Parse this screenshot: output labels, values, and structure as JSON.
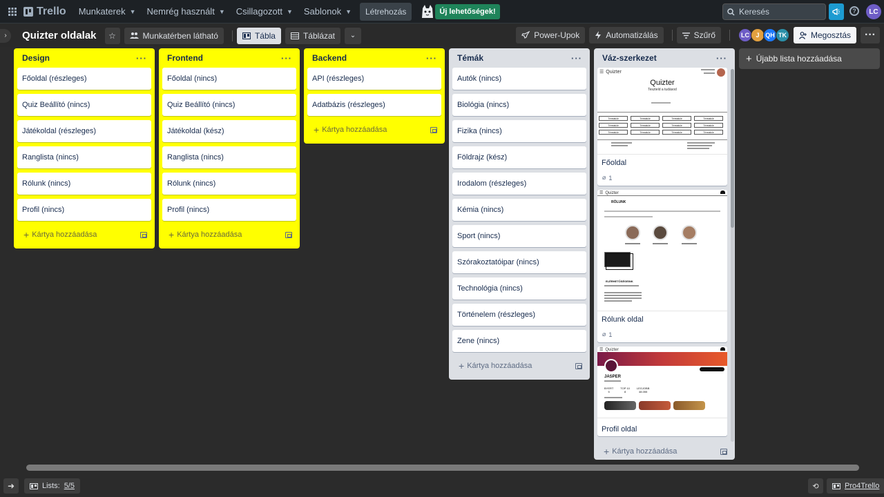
{
  "topnav": {
    "logo_text": "Trello",
    "menus": [
      "Munkaterek",
      "Nemrég használt",
      "Csillagozott",
      "Sablonok"
    ],
    "create_label": "Létrehozás",
    "new_badge": "Új lehetőségek!",
    "search_placeholder": "Keresés",
    "user_initials": "LC"
  },
  "boardbar": {
    "title": "Quizter oldalak",
    "visibility": "Munkatérben látható",
    "view_board": "Tábla",
    "view_table": "Táblázat",
    "powerups": "Power-Upok",
    "automation": "Automatizálás",
    "filter": "Szűrő",
    "share": "Megosztás",
    "members": [
      {
        "initials": "LC",
        "color": "#6e5dc6"
      },
      {
        "initials": "J",
        "color": "#e2a03f"
      },
      {
        "initials": "QH",
        "color": "#1d7afc"
      },
      {
        "initials": "TK",
        "color": "#2b8fa8"
      }
    ]
  },
  "lists": [
    {
      "title": "Design",
      "cards": [
        "Főoldal (részleges)",
        "Quiz Beállító (nincs)",
        "Játékoldal (részleges)",
        "Ranglista (nincs)",
        "Rólunk (nincs)",
        "Profil (nincs)"
      ],
      "add_label": "Kártya hozzáadása"
    },
    {
      "title": "Frontend",
      "cards": [
        "Főoldal (nincs)",
        "Quiz Beállító (nincs)",
        "Játékoldal (kész)",
        "Ranglista (nincs)",
        "Rólunk (nincs)",
        "Profil (nincs)"
      ],
      "add_label": "Kártya hozzáadása"
    },
    {
      "title": "Backend",
      "cards": [
        "API (részleges)",
        "Adatbázis (részleges)"
      ],
      "add_label": "Kártya hozzáadása"
    },
    {
      "title": "Témák",
      "cards": [
        "Autók (nincs)",
        "Biológia (nincs)",
        "Fizika (nincs)",
        "Földrajz (kész)",
        "Irodalom (részleges)",
        "Kémia (nincs)",
        "Sport (nincs)",
        "Szórakoztatóipar (nincs)",
        "Technológia (nincs)",
        "Történelem (részleges)",
        "Zene (nincs)"
      ],
      "add_label": "Kártya hozzáadása"
    },
    {
      "title": "Váz-szerkezet",
      "image_cards": [
        {
          "title": "Főoldal",
          "attachments": "1"
        },
        {
          "title": "Rólunk oldal",
          "attachments": "1"
        },
        {
          "title": "Profil oldal"
        }
      ],
      "add_label": "Kártya hozzáadása"
    }
  ],
  "add_list_label": "Újabb lista hozzáadása",
  "thumbnails": {
    "main": {
      "brand": "Quizter",
      "heading": "Quizter",
      "subheading": "Teszteld a tudásod",
      "topic_label": "Témakör"
    },
    "about": {
      "brand": "Quizter",
      "heading": "RÓLUNK",
      "contact_heading": "ELÉRHETŐSÉGEINK"
    },
    "profile": {
      "brand": "Quizter",
      "name": "JASPER",
      "stats": [
        {
          "label": "BYERT",
          "value": "5"
        },
        {
          "label": "TOP 10",
          "value": "8"
        },
        {
          "label": "LEGJOBB",
          "value": "48.055"
        }
      ]
    }
  },
  "bottombar": {
    "lists_label": "Lists:",
    "lists_count": "5/5",
    "pro_label": "Pro4Trello"
  }
}
